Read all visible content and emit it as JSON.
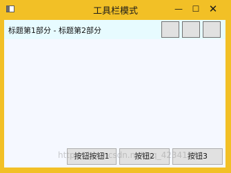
{
  "window": {
    "title": "工具栏模式",
    "icon": "window-app-icon",
    "controls": {
      "minimize_glyph": "—",
      "maximize_glyph": "☐",
      "close_glyph": "✕"
    }
  },
  "header": {
    "text": "标题第1部分 - 标题第2部分"
  },
  "toolbar": {
    "buttons": [
      "",
      "",
      ""
    ]
  },
  "footer": {
    "buttons": [
      {
        "label": "按钮按钮1"
      },
      {
        "label": "按钮2"
      },
      {
        "label": "按钮3"
      }
    ]
  },
  "watermark": {
    "text": "https://blog.csdn.net/qq_42341506"
  },
  "colors": {
    "frame": "#f2c026",
    "client_background": "#f5f8ff",
    "header_background": "#e7fbff",
    "button_face": "#e1e1e1"
  }
}
